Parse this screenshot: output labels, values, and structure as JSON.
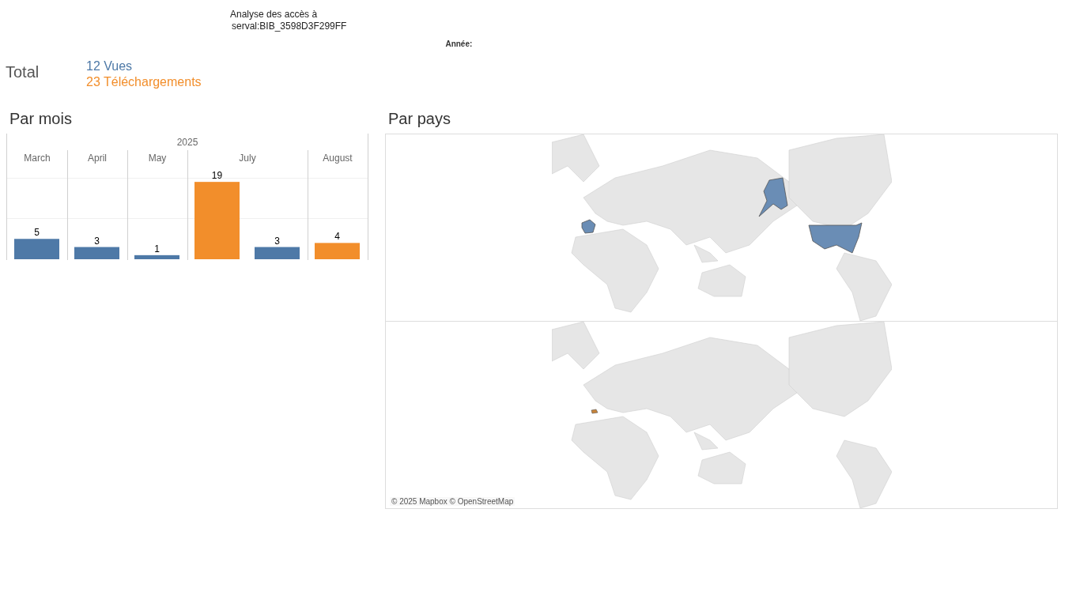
{
  "header": {
    "title_line_1": "Analyse des accès à",
    "title_line_2": "serval:BIB_3598D3F299FF",
    "year_filter_label": "Année:"
  },
  "total": {
    "label": "Total",
    "views": "12 Vues",
    "downloads": "23 Téléchargements"
  },
  "by_month": {
    "title": "Par mois",
    "year": "2025",
    "chart_data": {
      "type": "bar",
      "categories": [
        "March",
        "April",
        "May",
        "July",
        "August"
      ],
      "data_labels": true,
      "series": [
        {
          "color": "#f28e2b",
          "values": [
            null,
            null,
            null,
            19,
            4
          ]
        },
        {
          "color": "#4e79a7",
          "values": [
            5,
            3,
            1,
            3,
            null
          ]
        }
      ]
    }
  },
  "by_country": {
    "title": "Par pays",
    "attribution": "© 2025 Mapbox © OpenStreetMap"
  }
}
